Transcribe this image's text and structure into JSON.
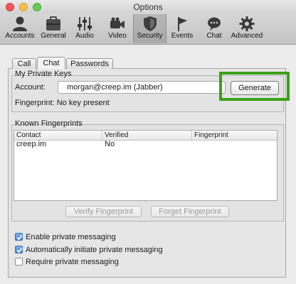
{
  "window": {
    "title": "Options"
  },
  "toolbar": {
    "items": [
      {
        "label": "Accounts",
        "icon": "accounts-icon"
      },
      {
        "label": "General",
        "icon": "general-icon"
      },
      {
        "label": "Audio",
        "icon": "audio-icon"
      },
      {
        "label": "Video",
        "icon": "video-icon"
      },
      {
        "label": "Security",
        "icon": "security-icon",
        "active": true
      },
      {
        "label": "Events",
        "icon": "events-icon"
      },
      {
        "label": "Chat",
        "icon": "chat-icon"
      },
      {
        "label": "Advanced",
        "icon": "advanced-icon"
      }
    ]
  },
  "tabs": [
    {
      "label": "Call"
    },
    {
      "label": "Chat",
      "active": true
    },
    {
      "label": "Passwords"
    }
  ],
  "private_keys": {
    "title": "My Private Keys",
    "account_label": "Account:",
    "account_value": "morgan@creep.im (Jabber)",
    "generate_label": "Generate",
    "fingerprint_text": "Fingerprint: No key present",
    "highlight_color": "#3aa117"
  },
  "known_fingerprints": {
    "title": "Known Fingerprints",
    "columns": [
      "Contact",
      "Verified",
      "Fingerprint"
    ],
    "rows": [
      {
        "contact": "creep.im",
        "verified": "No",
        "fingerprint": ""
      }
    ],
    "verify_label": "Verify Fingerprint",
    "forget_label": "Forget Fingerprint"
  },
  "options": [
    {
      "label": "Enable private messaging",
      "checked": true
    },
    {
      "label": "Automatically initiate private messaging",
      "checked": true
    },
    {
      "label": "Require private messaging",
      "checked": false
    }
  ]
}
